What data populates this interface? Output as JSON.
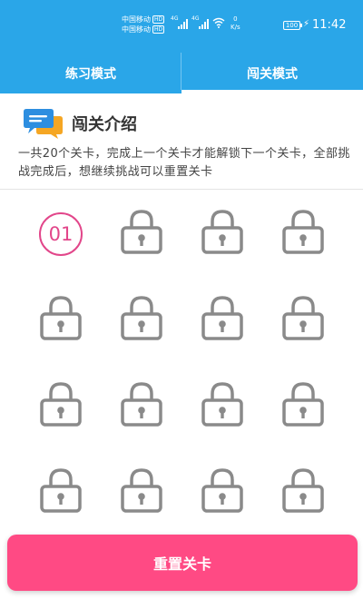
{
  "status_bar": {
    "carrier_1": "中国移动",
    "carrier_2": "中国移动",
    "hd_badge": "HD",
    "network_1": "4G",
    "network_2": "4G",
    "speed_value": "0",
    "speed_unit": "K/s",
    "battery": "100",
    "time": "11:42"
  },
  "tabs": [
    {
      "label": "练习模式",
      "selected": false
    },
    {
      "label": "闯关模式",
      "selected": true
    }
  ],
  "intro": {
    "title": "闯关介绍",
    "description": "一共20个关卡，完成上一个关卡才能解锁下一个关卡，全部挑战完成后，想继续挑战可以重置关卡"
  },
  "levels": {
    "total": 20,
    "unlocked_label": "01",
    "unlocked_count": 1
  },
  "reset_button": {
    "label": "重置关卡"
  },
  "colors": {
    "primary": "#2aa6e8",
    "accent": "#ff4a84",
    "badge": "#e2468a",
    "lock": "#8a8a8a"
  }
}
